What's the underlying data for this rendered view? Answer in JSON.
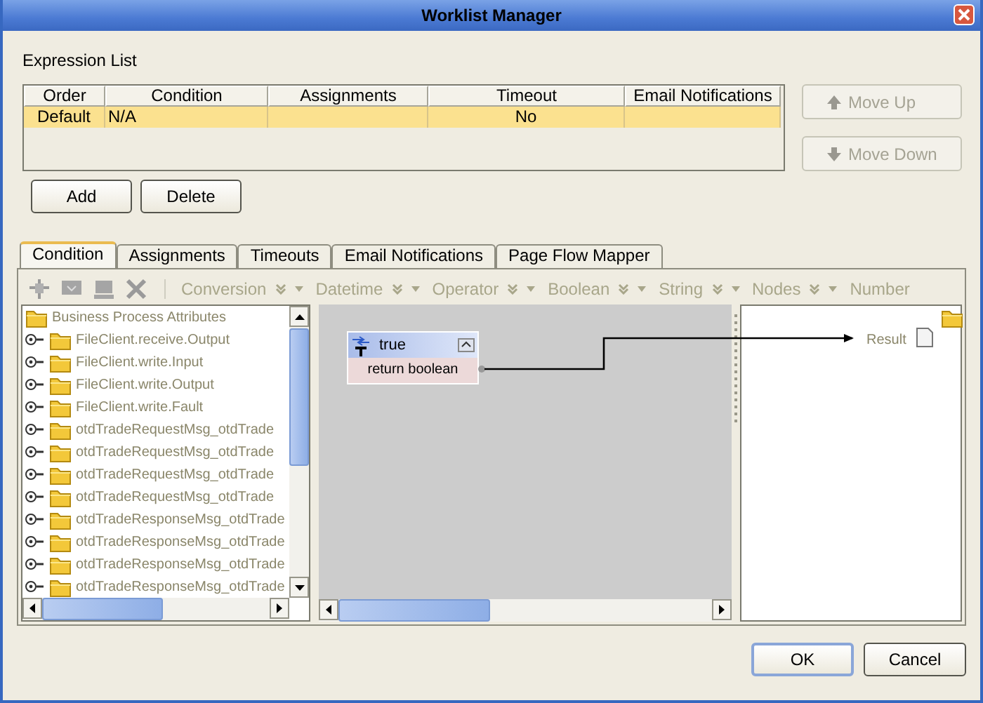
{
  "window": {
    "title": "Worklist Manager"
  },
  "expression_list": {
    "label": {
      "text": "Expression List"
    },
    "columns": [
      "Order",
      "Condition",
      "Assignments",
      "Timeout",
      "Email Notifications"
    ],
    "rows": [
      {
        "cells": [
          "Default",
          "N/A",
          "",
          "No",
          ""
        ],
        "selected": true
      }
    ],
    "side_buttons": [
      {
        "label": "Move Up",
        "disabled": true,
        "kind": "up"
      },
      {
        "label": "Move Down",
        "disabled": true,
        "kind": "down"
      }
    ],
    "buttons": [
      {
        "label": "Add"
      },
      {
        "label": "Delete"
      }
    ]
  },
  "tabs": [
    {
      "label": "Condition",
      "selected": true
    },
    {
      "label": "Assignments",
      "selected": false
    },
    {
      "label": "Timeouts",
      "selected": false
    },
    {
      "label": "Email Notifications",
      "selected": false
    },
    {
      "label": "Page Flow Mapper",
      "selected": false
    }
  ],
  "toolbar": {
    "menus": [
      {
        "label": "Conversion",
        "dropdown": true
      },
      {
        "label": "Datetime",
        "dropdown": true
      },
      {
        "label": "Operator",
        "dropdown": true
      },
      {
        "label": "Boolean",
        "dropdown": true
      },
      {
        "label": "String",
        "dropdown": true
      },
      {
        "label": "Nodes",
        "dropdown": true
      },
      {
        "label": "Number",
        "dropdown": false
      }
    ]
  },
  "tree": {
    "label": "Business Process Attributes",
    "children": [
      {
        "label": "FileClient.receive.Output"
      },
      {
        "label": "FileClient.write.Input"
      },
      {
        "label": "FileClient.write.Output"
      },
      {
        "label": "FileClient.write.Fault"
      },
      {
        "label": "otdTradeRequestMsg_otdTrade"
      },
      {
        "label": "otdTradeRequestMsg_otdTrade"
      },
      {
        "label": "otdTradeRequestMsg_otdTrade"
      },
      {
        "label": "otdTradeRequestMsg_otdTrade"
      },
      {
        "label": "otdTradeResponseMsg_otdTrade"
      },
      {
        "label": "otdTradeResponseMsg_otdTrade"
      },
      {
        "label": "otdTradeResponseMsg_otdTrade"
      },
      {
        "label": "otdTradeResponseMsg_otdTrade"
      }
    ]
  },
  "mapper": {
    "node": {
      "title": "true",
      "output": "return boolean"
    },
    "result": "Result"
  },
  "dialog_buttons": [
    {
      "label": "OK",
      "default": true
    },
    {
      "label": "Cancel",
      "default": false
    }
  ]
}
